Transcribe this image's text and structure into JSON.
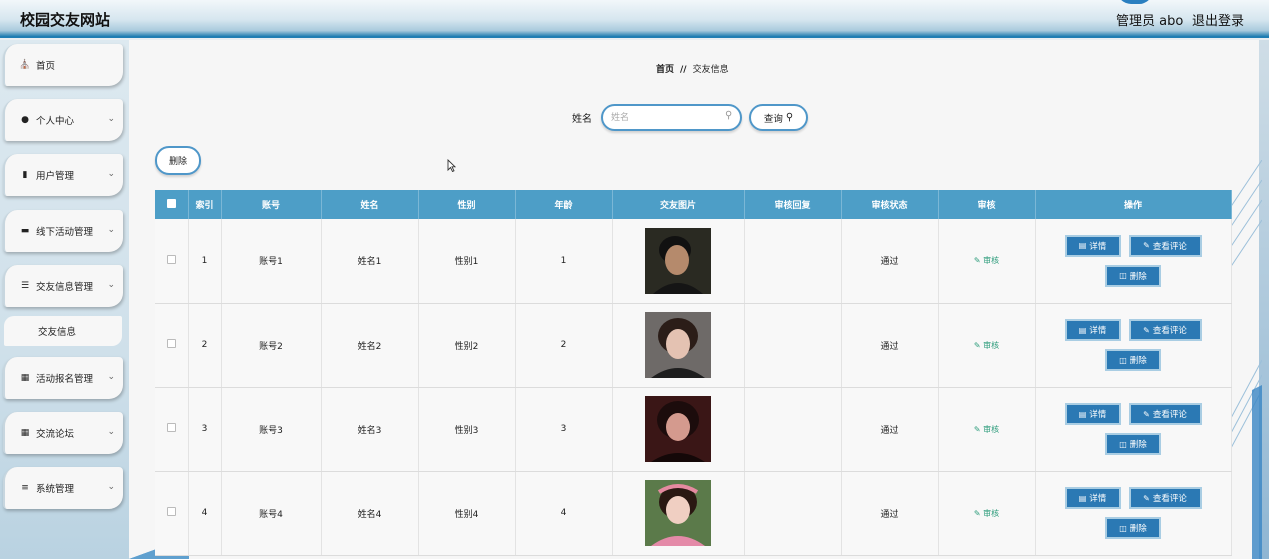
{
  "header": {
    "title": "校园交友网站",
    "admin": "管理员 abo",
    "logout": "退出登录"
  },
  "sidebar": {
    "items": [
      {
        "label": "首页",
        "icon": "home-icon"
      },
      {
        "label": "个人中心",
        "icon": "user-icon"
      },
      {
        "label": "用户管理",
        "icon": "clipboard-icon"
      },
      {
        "label": "线下活动管理",
        "icon": "briefcase-icon"
      },
      {
        "label": "交友信息管理",
        "icon": "list-icon"
      },
      {
        "label": "活动报名管理",
        "icon": "grid-icon"
      },
      {
        "label": "交流论坛",
        "icon": "grid-icon"
      },
      {
        "label": "系统管理",
        "icon": "sliders-icon"
      }
    ],
    "sub_item": "交友信息"
  },
  "breadcrumb": {
    "home": "首页",
    "sep": "//",
    "current": "交友信息"
  },
  "search": {
    "label": "姓名",
    "placeholder": "姓名",
    "button": "查询"
  },
  "toolbar": {
    "delete": "删除"
  },
  "table": {
    "headers": [
      "索引",
      "账号",
      "姓名",
      "性别",
      "年龄",
      "交友图片",
      "审核回复",
      "审核状态",
      "审核",
      "操作"
    ],
    "rows": [
      {
        "index": "1",
        "account": "账号1",
        "name": "姓名1",
        "gender": "性别1",
        "age": "1",
        "reply": "",
        "status": "通过"
      },
      {
        "index": "2",
        "account": "账号2",
        "name": "姓名2",
        "gender": "性别2",
        "age": "2",
        "reply": "",
        "status": "通过"
      },
      {
        "index": "3",
        "account": "账号3",
        "name": "姓名3",
        "gender": "性别3",
        "age": "3",
        "reply": "",
        "status": "通过"
      },
      {
        "index": "4",
        "account": "账号4",
        "name": "姓名4",
        "gender": "性别4",
        "age": "4",
        "reply": "",
        "status": "通过"
      }
    ],
    "audit_label": "审核",
    "actions": {
      "detail": "详情",
      "comments": "查看评论",
      "delete": "删除"
    }
  },
  "colors": {
    "accent": "#4d9ec7",
    "button": "#2b79b4",
    "audit": "#2b9b7a"
  }
}
